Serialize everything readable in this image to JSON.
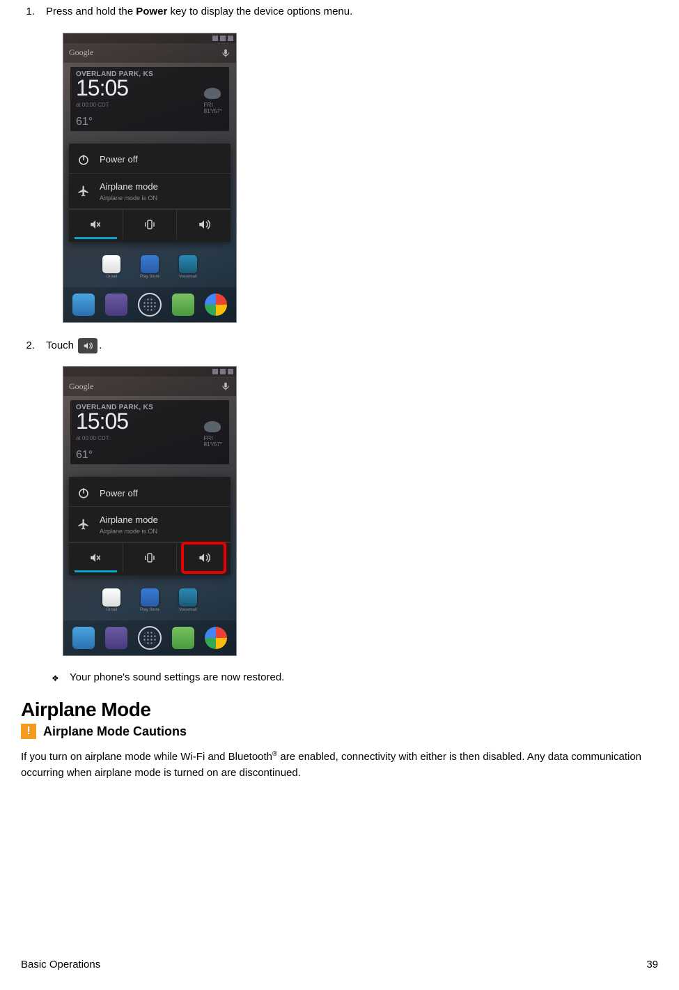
{
  "steps": {
    "s1": {
      "num": "1.",
      "pre": "Press and hold the ",
      "bold": "Power",
      "post": " key to display the device options menu."
    },
    "s2": {
      "num": "2.",
      "pre": "Touch ",
      "post": "."
    }
  },
  "note": {
    "bullet": "❖",
    "text": "Your phone's sound settings are now restored."
  },
  "section": {
    "title": "Airplane Mode",
    "caution_label": "Airplane Mode Cautions",
    "caution_icon": "!",
    "body_pre": "If you turn on airplane mode while Wi-Fi and Bluetooth",
    "body_sup": "®",
    "body_post": " are enabled, connectivity with either is then disabled. Any data communication occurring when airplane mode is turned on are discontinued."
  },
  "phone": {
    "search_label": "Google",
    "weather": {
      "location": "OVERLAND PARK, KS",
      "time": "15:05",
      "sub": "at 00:00 CDT",
      "temp": "61°",
      "day": "FRI",
      "hilo": "81°/57°"
    },
    "menu": {
      "power_off": "Power off",
      "airplane": "Airplane mode",
      "airplane_sub": "Airplane mode is ON"
    },
    "apps": {
      "a1": "Gmail",
      "a2": "Play Store",
      "a3": "Voicemail"
    }
  },
  "footer": {
    "section": "Basic Operations",
    "page": "39"
  }
}
